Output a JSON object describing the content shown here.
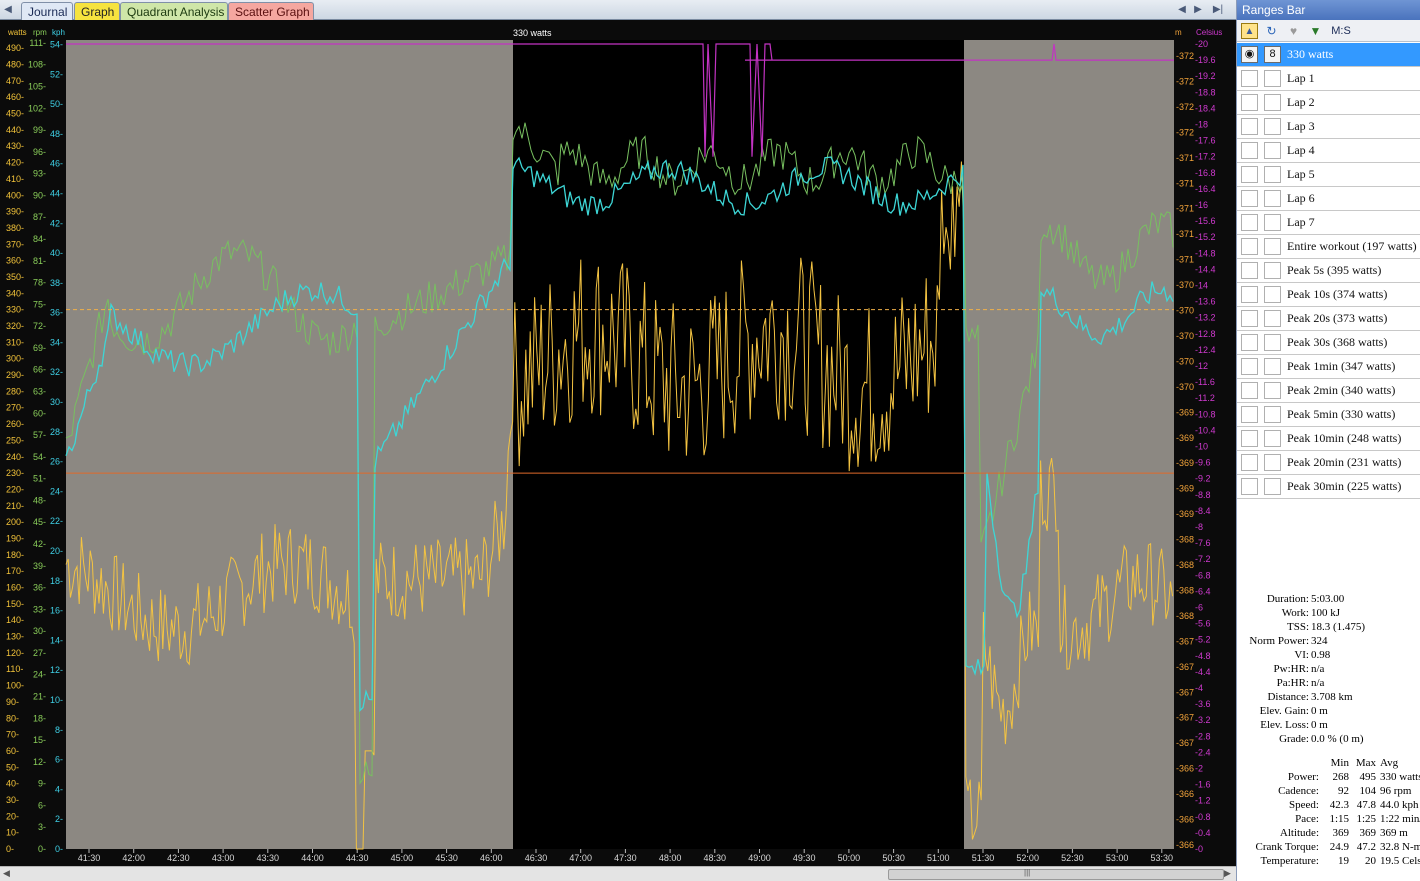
{
  "tabs": [
    {
      "label": "Journal"
    },
    {
      "label": "Graph"
    },
    {
      "label": "Quadrant Analysis"
    },
    {
      "label": "Scatter Graph"
    }
  ],
  "chart": {
    "selection_label": "330 watts",
    "axis_titles": {
      "watts": "watts",
      "rpm": "rpm",
      "kph": "kph",
      "m": "m",
      "celsius": "Celsius"
    },
    "x_ticks": [
      "41:30",
      "42:00",
      "42:30",
      "43:00",
      "43:30",
      "44:00",
      "44:30",
      "45:00",
      "45:30",
      "46:00",
      "46:30",
      "47:00",
      "47:30",
      "48:00",
      "48:30",
      "49:00",
      "49:30",
      "50:00",
      "50:30",
      "51:00",
      "51:30",
      "52:00",
      "52:30",
      "53:00",
      "53:30"
    ],
    "reference_lines": [
      {
        "name": "avg-power",
        "watts": 330,
        "color": "#f0b04a",
        "style": "dashed"
      },
      {
        "name": "ftp-line",
        "watts": 230,
        "color": "#e06a2a",
        "style": "solid"
      }
    ],
    "colors": {
      "power": "#f3c342",
      "cadence": "#78c060",
      "speed": "#3dd6d6",
      "altitude": "#c233c2",
      "watts_axis": "#f2c33a",
      "rpm_axis": "#8acd5a",
      "kph_axis": "#3fd0e6",
      "m_axis": "#f0a23a",
      "celsius_axis": "#d03ad0",
      "unselected_bg": "#8c8882",
      "selected_bg": "#000000"
    },
    "watts_ticks": [
      0,
      10,
      20,
      30,
      40,
      50,
      60,
      70,
      80,
      90,
      100,
      110,
      120,
      130,
      140,
      150,
      160,
      170,
      180,
      190,
      200,
      210,
      220,
      230,
      240,
      250,
      260,
      270,
      280,
      290,
      300,
      310,
      320,
      330,
      340,
      350,
      360,
      370,
      380,
      390,
      400,
      410,
      420,
      430,
      440,
      450,
      460,
      470,
      480,
      490
    ],
    "rpm_ticks": [
      0,
      3,
      6,
      9,
      12,
      15,
      18,
      21,
      24,
      27,
      30,
      33,
      36,
      39,
      42,
      45,
      48,
      51,
      54,
      57,
      60,
      63,
      66,
      69,
      72,
      75,
      78,
      81,
      84,
      87,
      90,
      93,
      96,
      99,
      102,
      105,
      108,
      111
    ],
    "kph_ticks": [
      0,
      2,
      4,
      6,
      8,
      10,
      12,
      14,
      16,
      18,
      20,
      22,
      24,
      26,
      28,
      30,
      32,
      34,
      36,
      38,
      40,
      42,
      44,
      46,
      48,
      50,
      52,
      54
    ],
    "m_ticks": [
      "366",
      "366",
      "366",
      "366",
      "367",
      "367",
      "367",
      "367",
      "367",
      "368",
      "368",
      "368",
      "368",
      "369",
      "369",
      "369",
      "369",
      "369",
      "370",
      "370",
      "370",
      "370",
      "370",
      "371",
      "371",
      "371",
      "371",
      "371",
      "372",
      "372",
      "372",
      "372"
    ],
    "celsius_ticks": [
      "0",
      "0.4",
      "0.8",
      "1.2",
      "1.6",
      "2",
      "2.4",
      "2.8",
      "3.2",
      "3.6",
      "4",
      "4.4",
      "4.8",
      "5.2",
      "5.6",
      "6",
      "6.4",
      "6.8",
      "7.2",
      "7.6",
      "8",
      "8.4",
      "8.8",
      "9.2",
      "9.6",
      "10",
      "10.4",
      "10.8",
      "11.2",
      "11.6",
      "12",
      "12.4",
      "12.8",
      "13.2",
      "13.6",
      "14",
      "14.4",
      "14.8",
      "15.2",
      "15.6",
      "16",
      "16.4",
      "16.8",
      "17.2",
      "17.6",
      "18",
      "18.4",
      "18.8",
      "19.2",
      "19.6",
      "20"
    ]
  },
  "ranges_bar": {
    "title": "Ranges Bar",
    "toolbar": {
      "ms_label": "M:S"
    },
    "items": [
      {
        "label": "330 watts",
        "selected": true
      },
      {
        "label": "Lap 1"
      },
      {
        "label": "Lap 2"
      },
      {
        "label": "Lap 3"
      },
      {
        "label": "Lap 4"
      },
      {
        "label": "Lap 5"
      },
      {
        "label": "Lap 6"
      },
      {
        "label": "Lap 7"
      },
      {
        "label": "Entire workout (197 watts)"
      },
      {
        "label": "Peak 5s (395 watts)"
      },
      {
        "label": "Peak 10s (374 watts)"
      },
      {
        "label": "Peak 20s (373 watts)"
      },
      {
        "label": "Peak 30s (368 watts)"
      },
      {
        "label": "Peak 1min (347 watts)"
      },
      {
        "label": "Peak 2min (340 watts)"
      },
      {
        "label": "Peak 5min (330 watts)"
      },
      {
        "label": "Peak 10min (248 watts)"
      },
      {
        "label": "Peak 20min (231 watts)"
      },
      {
        "label": "Peak 30min (225 watts)"
      }
    ],
    "summary": [
      {
        "key": "Duration:",
        "value": "5:03.00"
      },
      {
        "key": "Work:",
        "value": "100 kJ"
      },
      {
        "key": "TSS:",
        "value": "18.3 (1.475)"
      },
      {
        "key": "Norm Power:",
        "value": "324"
      },
      {
        "key": "VI:",
        "value": "0.98"
      },
      {
        "key": "Pw:HR:",
        "value": "n/a"
      },
      {
        "key": "Pa:HR:",
        "value": "n/a"
      },
      {
        "key": "Distance:",
        "value": "3.708 km"
      },
      {
        "key": "Elev. Gain:",
        "value": "0 m"
      },
      {
        "key": "Elev. Loss:",
        "value": "0 m"
      },
      {
        "key": "Grade:",
        "value": "0.0 % (0 m)"
      }
    ],
    "stats_header": {
      "min": "Min",
      "max": "Max",
      "avg": "Avg"
    },
    "stats": [
      {
        "key": "Power:",
        "min": "268",
        "max": "495",
        "avg": "330 watts"
      },
      {
        "key": "Cadence:",
        "min": "92",
        "max": "104",
        "avg": "96 rpm"
      },
      {
        "key": "Speed:",
        "min": "42.3",
        "max": "47.8",
        "avg": "44.0 kph"
      },
      {
        "key": "Pace:",
        "min": "1:15",
        "max": "1:25",
        "avg": "1:22 min/km"
      },
      {
        "key": "Altitude:",
        "min": "369",
        "max": "369",
        "avg": "369 m"
      },
      {
        "key": "Crank Torque:",
        "min": "24.9",
        "max": "47.2",
        "avg": "32.8 N-m"
      },
      {
        "key": "Temperature:",
        "min": "19",
        "max": "20",
        "avg": "19.5 Celsius"
      }
    ]
  }
}
